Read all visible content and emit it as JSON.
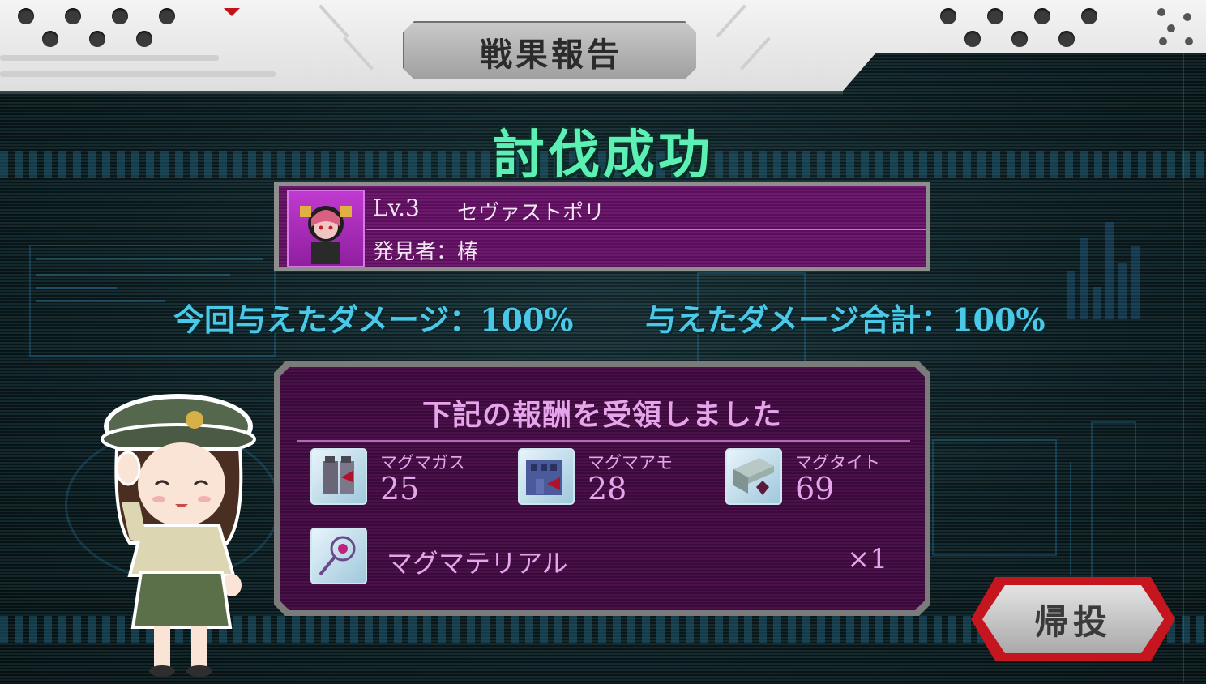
{
  "header": {
    "title": "戦果報告"
  },
  "result": {
    "status": "討伐成功"
  },
  "boss": {
    "level": "Lv.3",
    "name": "セヴァストポリ",
    "finder": "発見者：椿"
  },
  "damage": {
    "this_time": "今回与えたダメージ：100%",
    "total": "与えたダメージ合計：100%"
  },
  "rewards": {
    "title": "下記の報酬を受領しました",
    "resources": [
      {
        "name": "マグマガス",
        "value": "25",
        "icon": "gas-canister-icon"
      },
      {
        "name": "マグマアモ",
        "value": "28",
        "icon": "ammo-crate-icon"
      },
      {
        "name": "マグタイト",
        "value": "69",
        "icon": "steel-ingot-icon"
      }
    ],
    "material": {
      "name": "マグマテリアル",
      "qty": "×1",
      "icon": "magic-wand-icon"
    }
  },
  "buttons": {
    "return": "帰投"
  },
  "colors": {
    "victory": "#5df0b5",
    "damage": "#4ac8e6",
    "reward_text": "#e6a4ea",
    "boss_panel": "#5b0e5c",
    "return_border": "#c5151e"
  }
}
